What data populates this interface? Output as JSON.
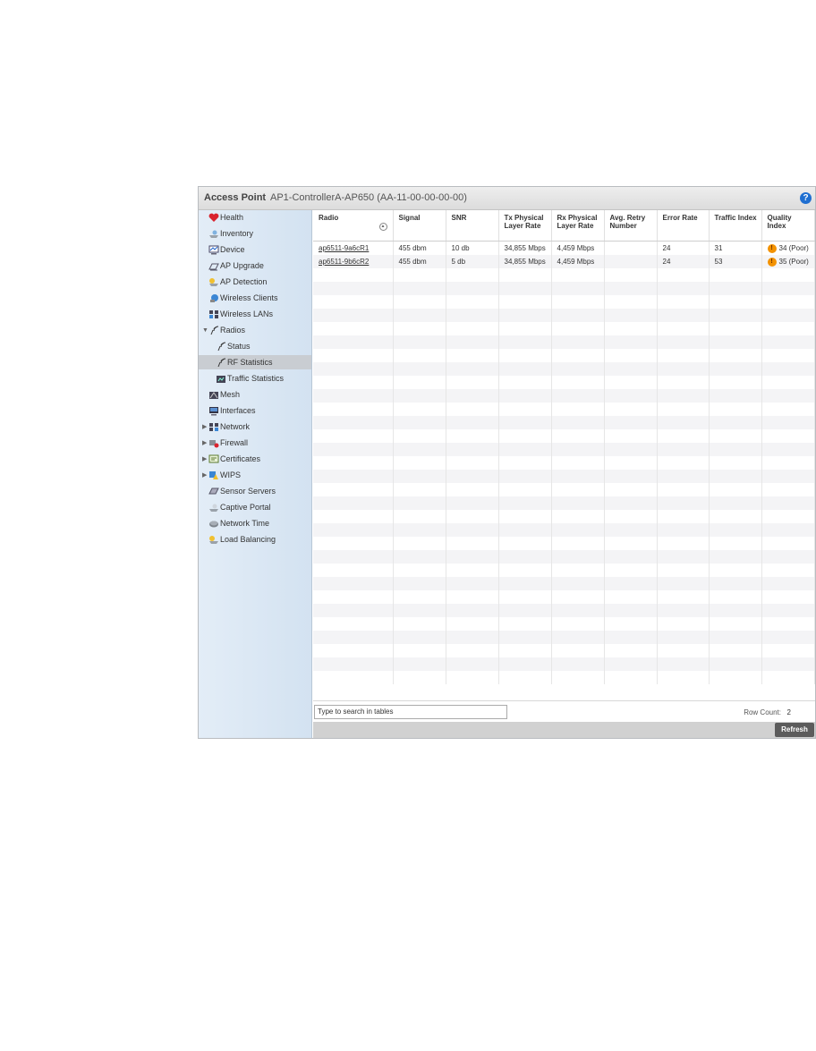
{
  "panel": {
    "title": "Access Point",
    "device": "AP1-ControllerA-AP650 (AA-11-00-00-00-00)",
    "help_icon": "help-icon"
  },
  "sidebar": {
    "items": [
      {
        "label": "Health",
        "icon": "health-icon"
      },
      {
        "label": "Inventory",
        "icon": "inventory-icon"
      },
      {
        "label": "Device",
        "icon": "device-icon"
      },
      {
        "label": "AP Upgrade",
        "icon": "upgrade-icon"
      },
      {
        "label": "AP Detection",
        "icon": "detection-icon"
      },
      {
        "label": "Wireless Clients",
        "icon": "clients-icon"
      },
      {
        "label": "Wireless LANs",
        "icon": "wlan-icon"
      },
      {
        "label": "Radios",
        "icon": "radio-icon"
      },
      {
        "label": "Status",
        "icon": "antenna-icon"
      },
      {
        "label": "RF Statistics",
        "icon": "antenna-icon"
      },
      {
        "label": "Traffic Statistics",
        "icon": "traffic-icon"
      },
      {
        "label": "Mesh",
        "icon": "mesh-icon"
      },
      {
        "label": "Interfaces",
        "icon": "interfaces-icon"
      },
      {
        "label": "Network",
        "icon": "network-icon"
      },
      {
        "label": "Firewall",
        "icon": "firewall-icon"
      },
      {
        "label": "Certificates",
        "icon": "certificate-icon"
      },
      {
        "label": "WIPS",
        "icon": "wips-icon"
      },
      {
        "label": "Sensor Servers",
        "icon": "sensor-icon"
      },
      {
        "label": "Captive Portal",
        "icon": "portal-icon"
      },
      {
        "label": "Network Time",
        "icon": "clock-icon"
      },
      {
        "label": "Load Balancing",
        "icon": "balance-icon"
      }
    ]
  },
  "table": {
    "headers": [
      "Radio",
      "Signal",
      "SNR",
      "Tx Physical Layer Rate",
      "Rx Physical Layer Rate",
      "Avg. Retry Number",
      "Error Rate",
      "Traffic Index",
      "Quality Index"
    ],
    "rows": [
      [
        "ap6511-9a6cR1",
        "455 dbm",
        "10 db",
        "34,855 Mbps",
        "4,459 Mbps",
        "",
        "24",
        "31",
        "34 (Poor)"
      ],
      [
        "ap6511-9b6cR2",
        "455 dbm",
        "5 db",
        "34,855 Mbps",
        "4,459 Mbps",
        "",
        "24",
        "53",
        "35 (Poor)"
      ]
    ]
  },
  "footer": {
    "search_placeholder": "Type to search in tables",
    "row_count_label": "Row Count:",
    "row_count_value": "2",
    "refresh_label": "Refresh"
  }
}
